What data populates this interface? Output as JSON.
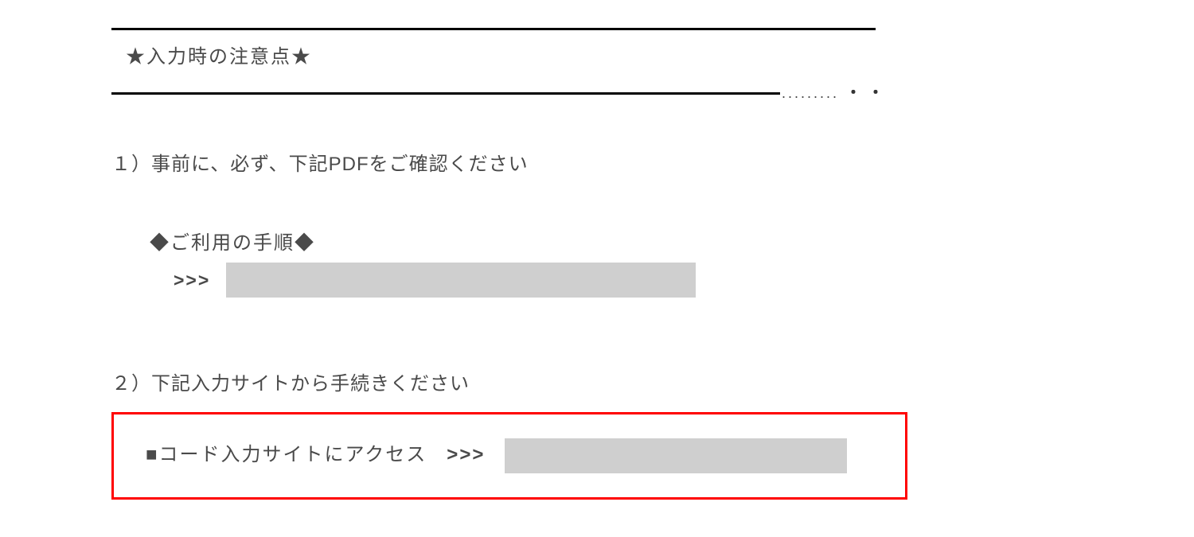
{
  "header": {
    "title": "★入力時の注意点★",
    "trail_small": ".........",
    "trail_dots": "・・"
  },
  "sections": {
    "s1": {
      "label": "１）事前に、必ず、下記PDFをご確認ください",
      "subtitle": "◆ご利用の手順◆",
      "arrow": ">>>"
    },
    "s2": {
      "label": "２）下記入力サイトから手続きください",
      "frame_text": "■コード入力サイトにアクセス",
      "arrow": ">>>"
    }
  }
}
